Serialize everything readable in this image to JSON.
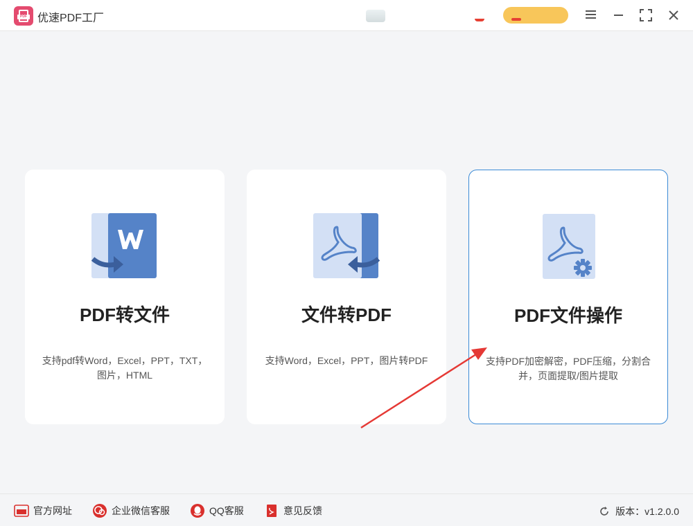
{
  "app": {
    "title": "优速PDF工厂"
  },
  "cards": [
    {
      "title": "PDF转文件",
      "description": "支持pdf转Word，Excel，PPT，TXT，图片，HTML",
      "icon": "pdf-to-word-icon"
    },
    {
      "title": "文件转PDF",
      "description": "支持Word，Excel，PPT，图片转PDF",
      "icon": "file-to-pdf-icon"
    },
    {
      "title": "PDF文件操作",
      "description": "支持PDF加密解密，PDF压缩，分割合并，页面提取/图片提取",
      "icon": "pdf-operations-icon"
    }
  ],
  "footer": {
    "links": [
      {
        "label": "官方网址",
        "icon": "website-icon"
      },
      {
        "label": "企业微信客服",
        "icon": "wechat-service-icon"
      },
      {
        "label": "QQ客服",
        "icon": "qq-icon"
      },
      {
        "label": "意见反馈",
        "icon": "feedback-icon"
      }
    ],
    "version": "版本：v1.2.0.0"
  },
  "colors": {
    "accent": "#3a8ad6",
    "brand": "#e44b6f",
    "icon_blue": "#5583c8",
    "icon_light": "#d3e0f5",
    "arrow_red": "#e53935"
  }
}
